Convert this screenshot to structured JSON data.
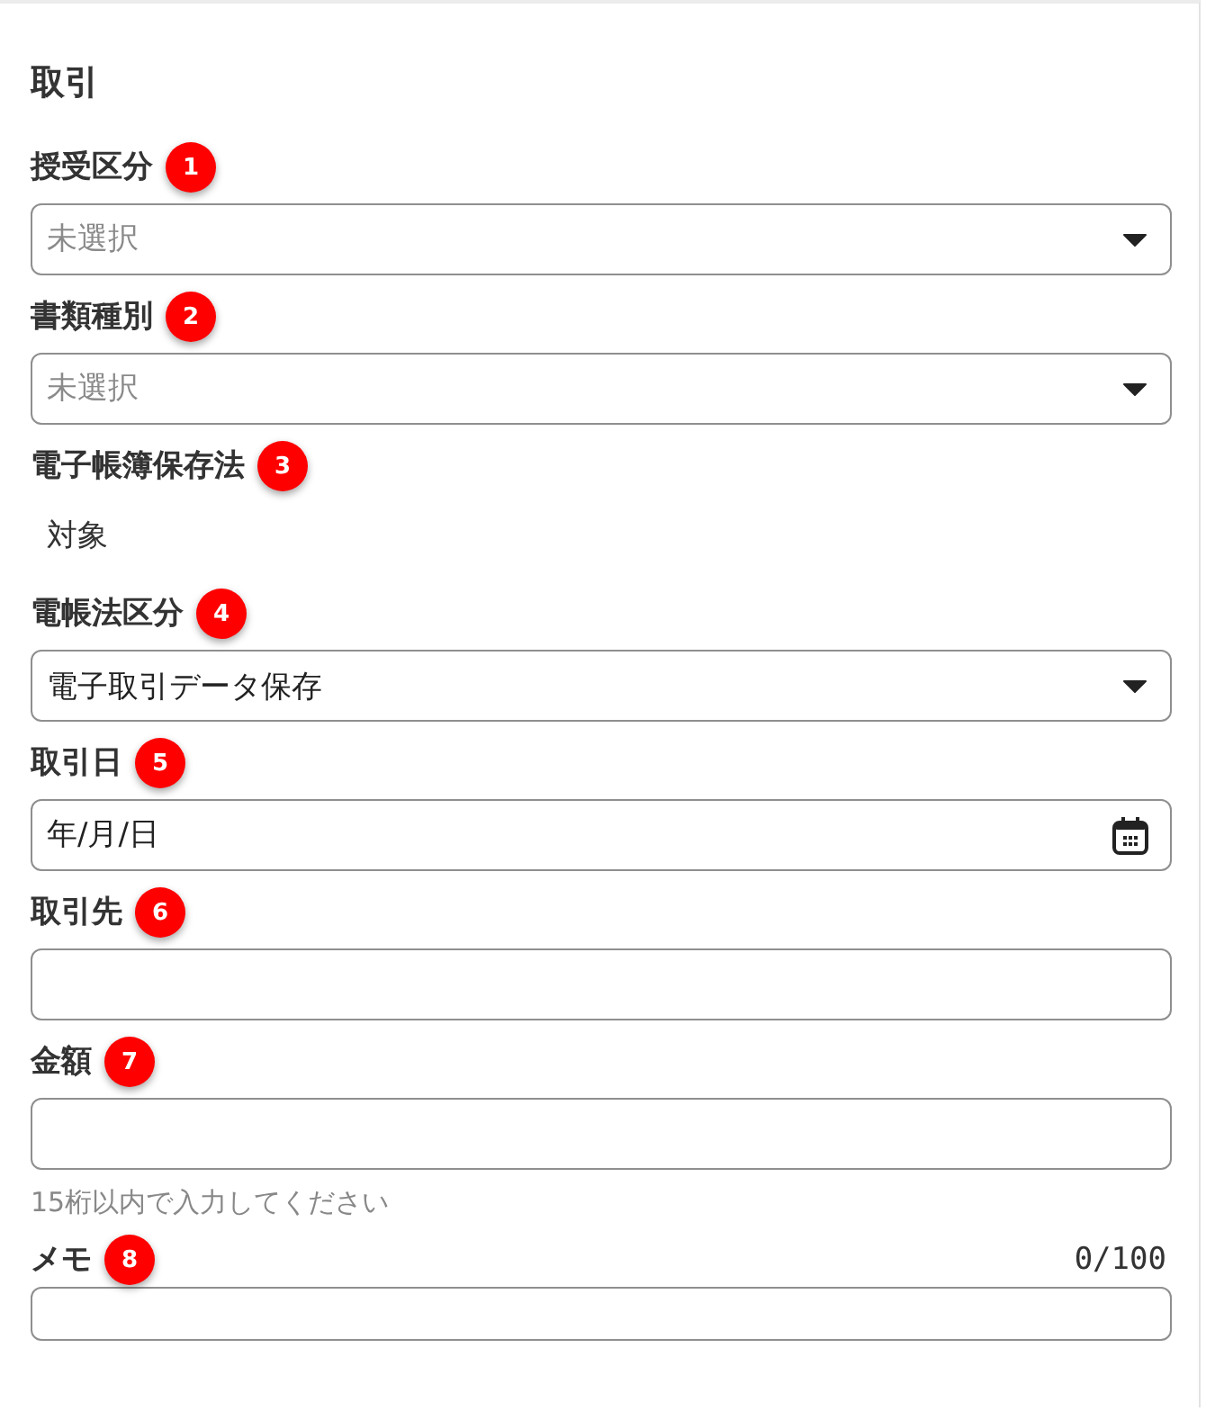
{
  "section": {
    "title": "取引"
  },
  "fields": [
    {
      "kind": "select",
      "label": "授受区分",
      "badge": "1",
      "placeholder": "未選択"
    },
    {
      "kind": "select",
      "label": "書類種別",
      "badge": "2",
      "placeholder": "未選択"
    },
    {
      "kind": "static",
      "label": "電子帳簿保存法",
      "badge": "3",
      "value": "対象"
    },
    {
      "kind": "select",
      "label": "電帳法区分",
      "badge": "4",
      "value": "電子取引データ保存"
    },
    {
      "kind": "date",
      "label": "取引日",
      "badge": "5",
      "placeholder": "年/月/日"
    },
    {
      "kind": "text",
      "label": "取引先",
      "badge": "6"
    },
    {
      "kind": "text",
      "label": "金額",
      "badge": "7",
      "hint": "15桁以内で入力してください"
    },
    {
      "kind": "memo",
      "label": "メモ",
      "badge": "8",
      "counter": "0/100"
    }
  ]
}
